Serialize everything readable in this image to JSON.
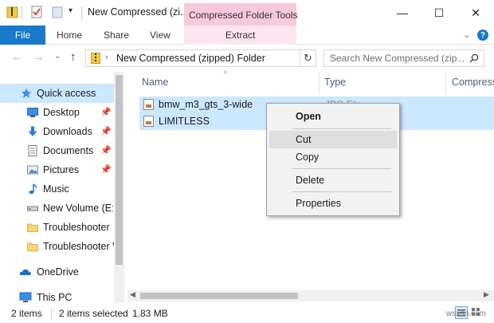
{
  "window": {
    "title": "New Compressed (zi...",
    "context_tab_group": "Compressed Folder Tools",
    "controls": {
      "minimize": "—",
      "maximize": "☐",
      "close": "✕"
    }
  },
  "ribbon": {
    "tabs": [
      {
        "label": "File"
      },
      {
        "label": "Home"
      },
      {
        "label": "Share"
      },
      {
        "label": "View"
      },
      {
        "label": "Extract"
      }
    ],
    "collapse_chevron": "⌄",
    "help": "?"
  },
  "address": {
    "path": "New Compressed (zipped) Folder",
    "back": "←",
    "forward": "→",
    "recent": "⌄",
    "up": "↑",
    "dropdown": "⌄",
    "refresh": "↻"
  },
  "search": {
    "placeholder": "Search New Compressed (zip..."
  },
  "nav_pane": {
    "items": [
      {
        "label": "Quick access",
        "icon": "star-icon",
        "selected": true,
        "pinned": false
      },
      {
        "label": "Desktop",
        "icon": "desktop-icon",
        "pinned": true
      },
      {
        "label": "Downloads",
        "icon": "download-icon",
        "pinned": true
      },
      {
        "label": "Documents",
        "icon": "documents-icon",
        "pinned": true
      },
      {
        "label": "Pictures",
        "icon": "pictures-icon",
        "pinned": true
      },
      {
        "label": "Music",
        "icon": "music-icon",
        "pinned": false
      },
      {
        "label": "New Volume (E:)",
        "icon": "drive-icon",
        "pinned": false
      },
      {
        "label": "Troubleshooter",
        "icon": "folder-icon",
        "pinned": false
      },
      {
        "label": "Troubleshooter V",
        "icon": "folder-icon",
        "pinned": false
      },
      {
        "label": "OneDrive",
        "icon": "onedrive-icon",
        "pinned": false
      },
      {
        "label": "This PC",
        "icon": "this-pc-icon",
        "pinned": false
      }
    ]
  },
  "file_list": {
    "columns": [
      "Name",
      "Type",
      "Compress"
    ],
    "rows": [
      {
        "name": "bmw_m3_gts_3-wide",
        "type": "JPG File",
        "selected": true
      },
      {
        "name": "LIMITLESS",
        "type": "",
        "selected": true
      }
    ]
  },
  "context_menu": {
    "items": [
      {
        "label": "Open",
        "bold": true
      },
      {
        "label": "Cut",
        "hover": true
      },
      {
        "label": "Copy"
      },
      {
        "label": "Delete"
      },
      {
        "label": "Properties"
      }
    ]
  },
  "status_bar": {
    "item_count": "2 items",
    "selection": "2 items selected",
    "size": "1.83 MB"
  },
  "watermark": "wsxdn.com",
  "colors": {
    "accent": "#1979ca",
    "selection": "#cce8ff",
    "context_tab": "#f8c8dc"
  }
}
